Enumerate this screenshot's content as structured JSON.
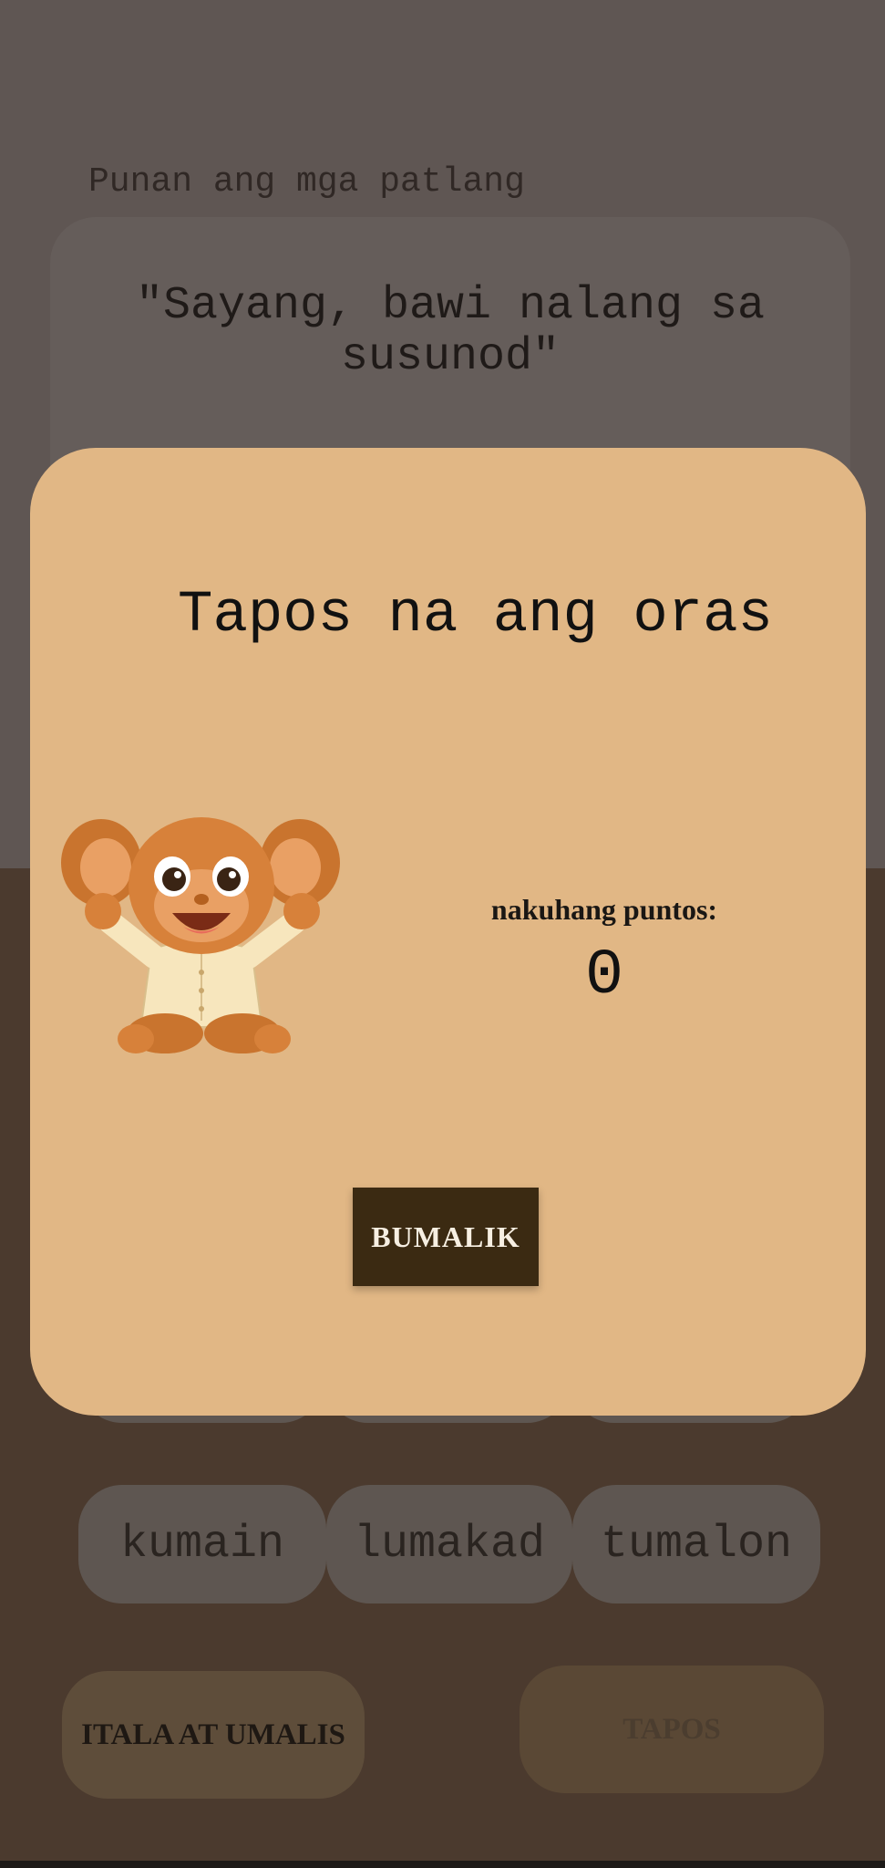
{
  "game": {
    "instruction": "Punan ang mga patlang",
    "sentence": "\"Sayang, bawi nalang sa susunod\"",
    "choices": [
      "kumain",
      "lumakad",
      "tumalon"
    ]
  },
  "buttons": {
    "save_exit_label": "ITALA AT UMALIS",
    "finish_label": "TAPOS"
  },
  "modal": {
    "title": "Tapos na ang oras",
    "score_label": "nakuhang puntos:",
    "score_value": "0",
    "back_label": "BUMALIK",
    "mascot_icon": "mascot-character-icon"
  },
  "colors": {
    "modal_bg": "#e1b785",
    "back_button_bg": "#3b2a12",
    "dim_overlay_top": "#5f5653",
    "dim_overlay_bottom": "#4b3a2e"
  }
}
